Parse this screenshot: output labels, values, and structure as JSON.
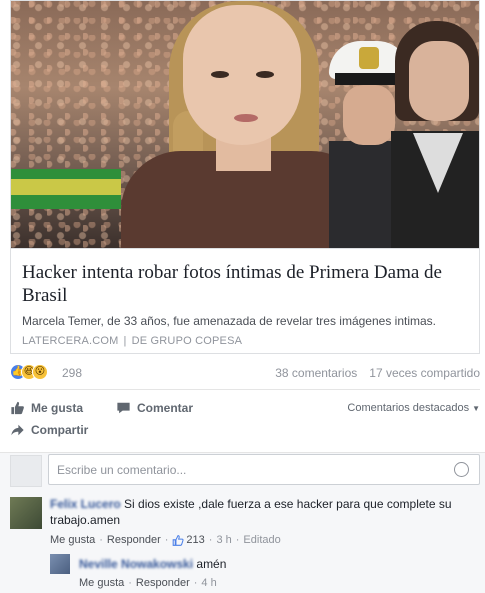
{
  "post": {
    "link": {
      "headline": "Hacker intenta robar fotos íntimas de Primera Dama de Brasil",
      "description": "Marcela Temer, de 33 años, fue amenazada de revelar tres imágenes intimas.",
      "source": "LATERCERA.COM",
      "source_separator": "|",
      "publisher": "DE GRUPO COPESA"
    },
    "reactions": {
      "count": "298",
      "comments": "38 comentarios",
      "shares": "17 veces compartido",
      "icons": [
        "like-icon",
        "haha-icon",
        "wow-icon"
      ]
    },
    "actions": {
      "like": "Me gusta",
      "comment": "Comentar",
      "share": "Compartir",
      "featured": "Comentarios destacados"
    },
    "comment_box": {
      "placeholder": "Escribe un comentario..."
    },
    "comments": [
      {
        "author": "Felix Lucero",
        "text": "Si dios existe ,dale fuerza a ese hacker para que complete su trabajo.amen",
        "like_label": "Me gusta",
        "reply_label": "Responder",
        "likes": "213",
        "time": "3 h",
        "edited": "Editado"
      },
      {
        "author": "Neville Nowakowski",
        "text": "amén",
        "like_label": "Me gusta",
        "reply_label": "Responder",
        "time": "4 h"
      }
    ]
  },
  "colors": {
    "link_blue": "#365899",
    "like_blue": "#4a7fe8",
    "muted": "#90949c"
  }
}
